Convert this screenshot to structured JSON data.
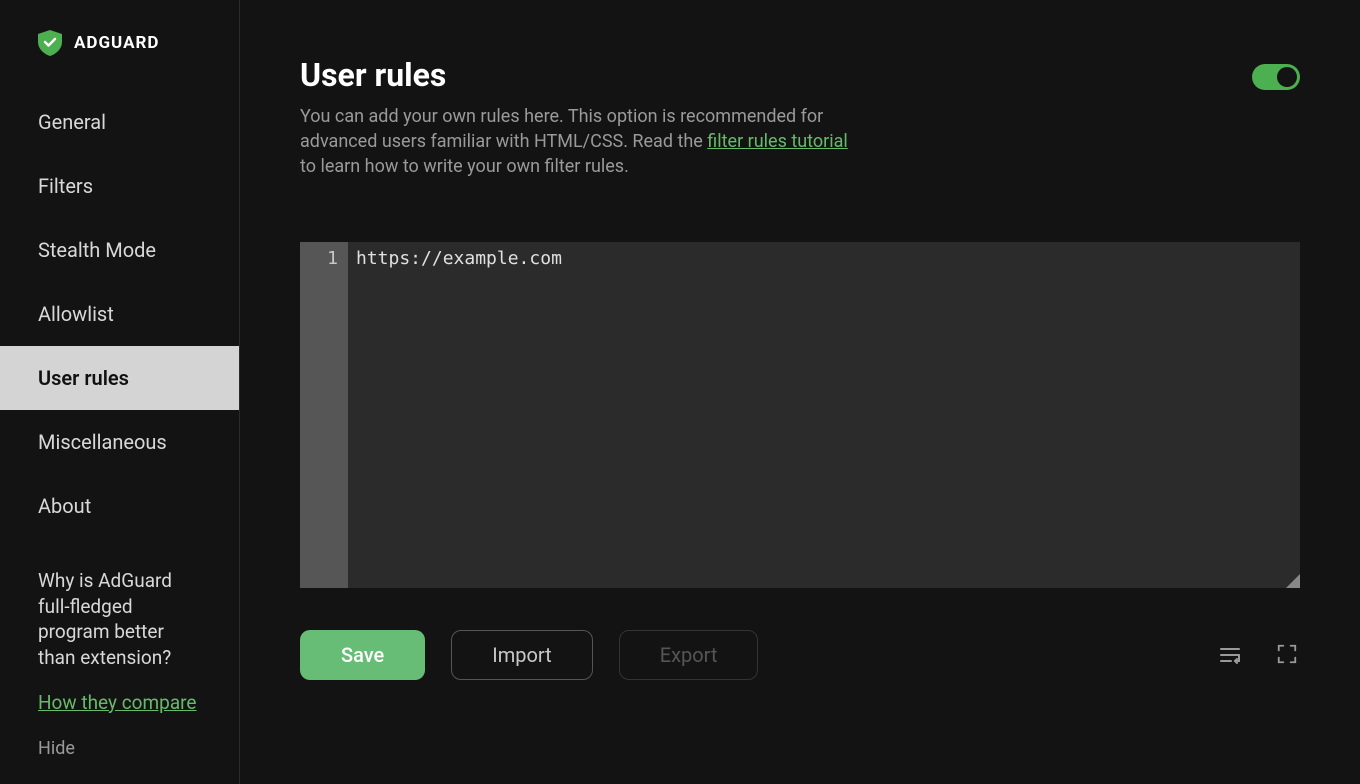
{
  "app": {
    "name": "ADGUARD"
  },
  "sidebar": {
    "items": [
      {
        "label": "General"
      },
      {
        "label": "Filters"
      },
      {
        "label": "Stealth Mode"
      },
      {
        "label": "Allowlist"
      },
      {
        "label": "User rules"
      },
      {
        "label": "Miscellaneous"
      },
      {
        "label": "About"
      }
    ],
    "promo": {
      "title": "Why is AdGuard full-fledged program better than extension?",
      "link_text": "How they compare",
      "hide": "Hide"
    }
  },
  "page": {
    "title": "User rules",
    "desc_prefix": "You can add your own rules here. This option is recommended for advanced users familiar with HTML/CSS. Read the ",
    "desc_link": "filter rules tutorial",
    "desc_suffix": " to learn how to write your own filter rules.",
    "toggle_on": true
  },
  "editor": {
    "line_number": "1",
    "content": "https://example.com"
  },
  "buttons": {
    "save": "Save",
    "import": "Import",
    "export": "Export"
  }
}
